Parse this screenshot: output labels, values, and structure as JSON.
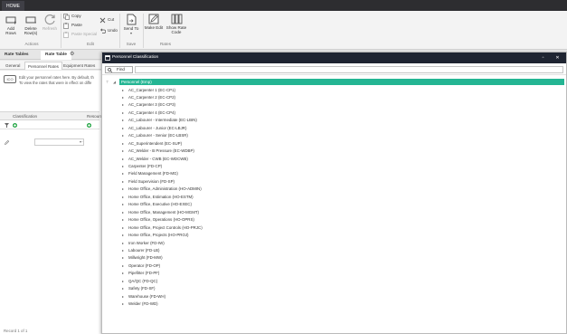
{
  "titlebar": {
    "home_tab": "HOME"
  },
  "ribbon": {
    "add_rows": "Add Rows",
    "delete_rows": "Delete Row(s)",
    "refresh": "Refresh",
    "copy": "Copy",
    "paste": "Paste",
    "paste_special": "Paste Special",
    "cut": "Cut",
    "undo": "Undo",
    "send_to": "Send To",
    "make_edit": "Make Edit",
    "show_rate_code": "Show Rate Code",
    "groups": {
      "actions": "Actions",
      "edit": "Edit",
      "save": "Save",
      "rates": "Rates"
    }
  },
  "doc_tabs": {
    "rate_tables": "Rate Tables",
    "rate_table": "Rate Table"
  },
  "sub_tabs": [
    "General",
    "Personnel Rates",
    "Equipment Rates"
  ],
  "info": {
    "icon_text": "ICO",
    "line1": "Edit your personnel rates here. By default, th",
    "line2": "To view the rates that were in effect on diffe"
  },
  "grid": {
    "col_classification": "Classification",
    "col_resource": "Resource"
  },
  "record_status": "Record 1 of 1",
  "modal": {
    "title": "Personnel Classification",
    "find_label": "Find",
    "root_label": "Personnel (Emp)",
    "items": [
      "AC_Carpenter 1 (EC-CP1)",
      "AC_Carpenter 2 (EC-CP2)",
      "AC_Carpenter 3 (EC-CP3)",
      "AC_Carpenter 4 (EC-CP4)",
      "AC_Labourer - Intermediate (EC-LBIN)",
      "AC_Labourer - Junior (EC-LBJR)",
      "AC_Labourer - Senior (EC-LBSR)",
      "AC_Superintendent (EC-SUP)",
      "AC_Welder - B Pressure (EC-WDBP)",
      "AC_Welder - CWB (EC-WDCWB)",
      "Carpenter (FD-CP)",
      "Field Management (FD-MG)",
      "Field Supervision (FD-SP)",
      "Home Office, Administration (HO-ADMIN)",
      "Home Office, Estimation (HO-ESTM)",
      "Home Office, Executive (HO-EXEC)",
      "Home Office, Management (HO-MGMT)",
      "Home Office, Operations (HO-OPRS)",
      "Home Office, Project Controls (HO-PRJC)",
      "Home Office, Projects (HO-PROJ)",
      "Iron Worker (FD-IW)",
      "Labourer (FD-LB)",
      "Millwright (FD-MW)",
      "Operator (FD-OP)",
      "Pipefitter (FD-PF)",
      "QA/QC (FD-QC)",
      "Safety (FD-SF)",
      "Warehouse (FD-WH)",
      "Welder (FD-WD)"
    ]
  },
  "colors": {
    "accent": "#24b593",
    "modal_title_bg": "#1f2532",
    "titlebar_bg": "#2d2d30"
  }
}
